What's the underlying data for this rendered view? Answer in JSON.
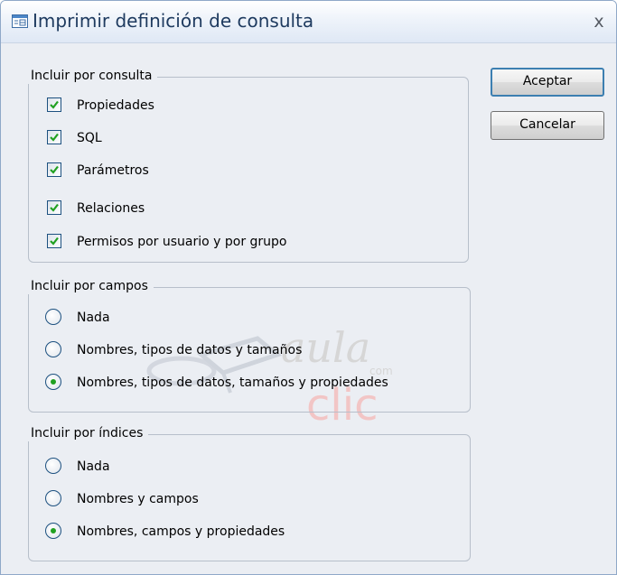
{
  "window": {
    "title": "Imprimir definición de consulta",
    "title_icon": "table-properties-icon",
    "close_label": "x"
  },
  "groups": {
    "consulta": {
      "label": "Incluir por consulta",
      "items": [
        {
          "label": "Propiedades",
          "checked": true
        },
        {
          "label": "SQL",
          "checked": true
        },
        {
          "label": "Parámetros",
          "checked": true
        },
        {
          "label": "Relaciones",
          "checked": true
        },
        {
          "label": "Permisos por usuario y por grupo",
          "checked": true
        }
      ]
    },
    "campos": {
      "label": "Incluir por campos",
      "items": [
        {
          "label": "Nada",
          "selected": false
        },
        {
          "label": "Nombres, tipos de datos y tamaños",
          "selected": false
        },
        {
          "label": "Nombres, tipos de datos, tamaños y propiedades",
          "selected": true
        }
      ]
    },
    "indices": {
      "label": "Incluir por índices",
      "items": [
        {
          "label": "Nada",
          "selected": false
        },
        {
          "label": "Nombres y campos",
          "selected": false
        },
        {
          "label": "Nombres, campos y propiedades",
          "selected": true
        }
      ]
    }
  },
  "buttons": {
    "ok": "Aceptar",
    "cancel": "Cancelar"
  },
  "watermark": {
    "word1": "aula",
    "small": "com",
    "word2": "clic"
  },
  "colors": {
    "check": "#21a121",
    "radio_dot": "#21a121",
    "accent": "#3c7fb1"
  }
}
